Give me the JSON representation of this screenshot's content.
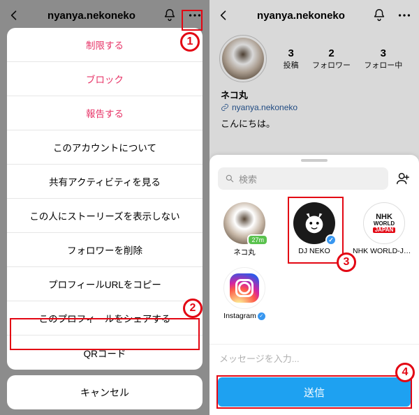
{
  "header": {
    "username": "nyanya.nekoneko"
  },
  "stats": {
    "posts": {
      "count": "3",
      "label": "投稿"
    },
    "followers": {
      "count": "2",
      "label": "フォロワー"
    },
    "following": {
      "count": "3",
      "label": "フォロー中"
    }
  },
  "profile": {
    "display_name": "ネコ丸",
    "link_text": "nyanya.nekoneko",
    "bio": "こんにちは。"
  },
  "sheet": {
    "items": [
      {
        "label": "制限する",
        "danger": true
      },
      {
        "label": "ブロック",
        "danger": true
      },
      {
        "label": "報告する",
        "danger": true
      },
      {
        "label": "このアカウントについて",
        "danger": false
      },
      {
        "label": "共有アクティビティを見る",
        "danger": false
      },
      {
        "label": "この人にストーリーズを表示しない",
        "danger": false
      },
      {
        "label": "フォロワーを削除",
        "danger": false
      },
      {
        "label": "プロフィールURLをコピー",
        "danger": false
      },
      {
        "label": "このプロフィールをシェアする",
        "danger": false
      },
      {
        "label": "QRコード",
        "danger": false
      }
    ],
    "cancel": "キャンセル"
  },
  "share": {
    "search_placeholder": "検索",
    "targets": [
      {
        "name": "ネコ丸",
        "avatar": "cat",
        "time": "27m"
      },
      {
        "name": "DJ NEKO",
        "avatar": "dj",
        "verified": true
      },
      {
        "name": "NHK WORLD-JAPAN…",
        "avatar": "nhk"
      },
      {
        "name": "Instagram",
        "avatar": "ig",
        "verified_inline": true
      }
    ],
    "message_placeholder": "メッセージを入力...",
    "send_label": "送信"
  },
  "nhk": {
    "l1": "NHK",
    "l2": "WORLD",
    "l3": "JAPAN"
  },
  "callouts": {
    "c1": "1",
    "c2": "2",
    "c3": "3",
    "c4": "4"
  }
}
